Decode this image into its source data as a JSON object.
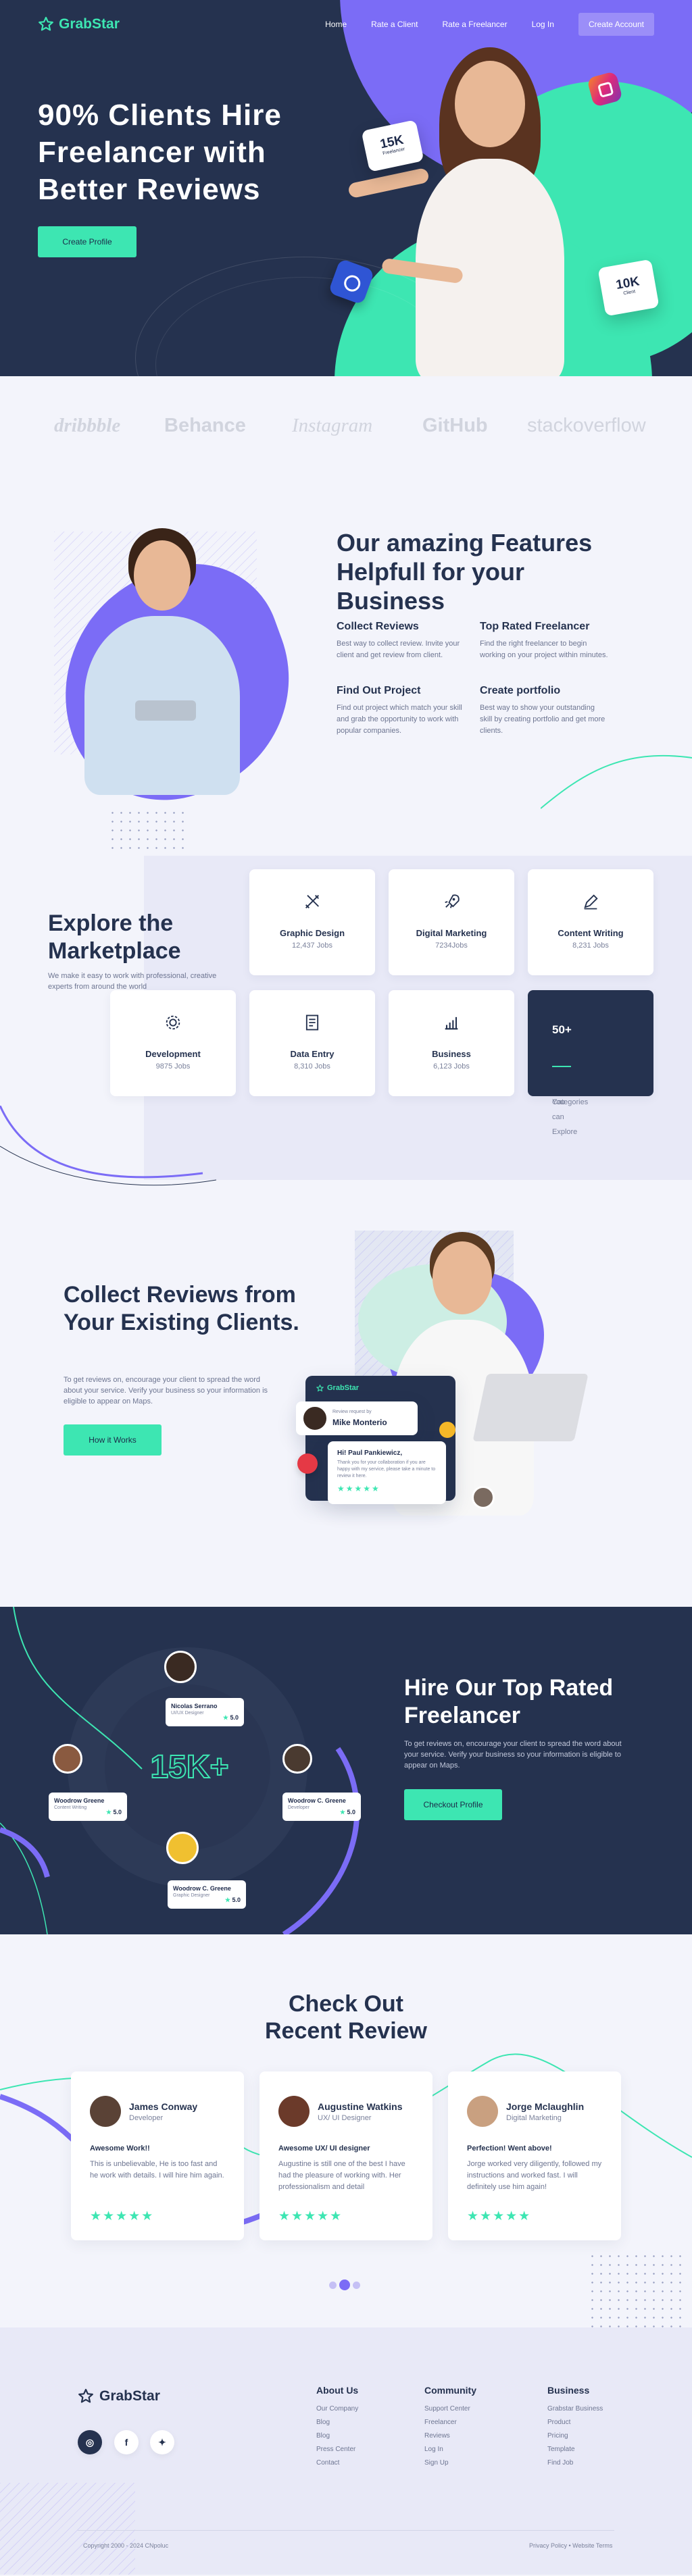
{
  "brand": {
    "name": "GrabStar",
    "accent": "#3de6b2",
    "purple": "#7b6cf6",
    "navy": "#25324f"
  },
  "nav": {
    "links": [
      "Home",
      "Rate a Client",
      "Rate a Freelancer",
      "Log In"
    ],
    "cta": "Create Account"
  },
  "hero": {
    "title": "90% Clients Hire Freelancer with Better Reviews",
    "button": "Create Profile",
    "badge1": {
      "value": "15K",
      "label": "Freelancer"
    },
    "badge2": {
      "value": "10K",
      "label": "Client"
    }
  },
  "brands": [
    "dribbble",
    "Behance",
    "Instagram",
    "GitHub",
    "stackoverflow"
  ],
  "features": {
    "title": "Our amazing Features Helpfull for your Business",
    "items": [
      {
        "title": "Collect Reviews",
        "text": "Best way to collect review. Invite your client and get review from client."
      },
      {
        "title": "Top Rated Freelancer",
        "text": "Find the right freelancer to begin working on your project within minutes."
      },
      {
        "title": "Find Out Project",
        "text": "Find out project which match your skill and grab the opportunity to work with popular companies."
      },
      {
        "title": "Create portfolio",
        "text": "Best way to show your outstanding skill by creating portfolio and get more clients."
      }
    ]
  },
  "market": {
    "title": "Explore the Marketplace",
    "subtitle": "We make it easy to work with professional, creative experts from around the world",
    "categories": [
      {
        "name": "Graphic Design",
        "jobs": "12,437 Jobs",
        "icon": "pencil-ruler-icon"
      },
      {
        "name": "Digital Marketing",
        "jobs": "7234Jobs",
        "icon": "rocket-icon"
      },
      {
        "name": "Content Writing",
        "jobs": "8,231 Jobs",
        "icon": "pen-icon"
      },
      {
        "name": "Development",
        "jobs": "9875 Jobs",
        "icon": "gear-icon"
      },
      {
        "name": "Data Entry",
        "jobs": "8,310 Jobs",
        "icon": "document-icon"
      },
      {
        "name": "Business",
        "jobs": "6,123 Jobs",
        "icon": "chart-icon"
      }
    ],
    "more": {
      "count": "50+",
      "label1": "Categories",
      "label2": "You can Explore"
    }
  },
  "collect": {
    "title": "Collect Reviews from Your Existing Clients.",
    "subtitle": "To get reviews on, encourage your client to spread the word about your service. Verify your business so your information is eligible to appear on Maps.",
    "button": "How it Works",
    "widget_brand": "GrabStar",
    "review_request": {
      "label": "Review request by",
      "name": "Mike Monterio"
    },
    "message": {
      "greeting": "Hi! Paul Pankiewicz,",
      "text": "Thank you for your collaboration if you are happy with my service, please take a minute to review it here."
    }
  },
  "hire": {
    "title": "Hire Our Top Rated Freelancer",
    "subtitle": "To get reviews on, encourage your client to spread the word about your service. Verify your business so your information is eligible to appear on Maps.",
    "button": "Checkout Profile",
    "counter": "15K+",
    "freelancers": [
      {
        "name": "Nicolas Serrano",
        "role": "UI/UX Designer",
        "rating": "5.0"
      },
      {
        "name": "Woodrow Greene",
        "role": "Content Writing",
        "rating": "5.0"
      },
      {
        "name": "Woodrow C. Greene",
        "role": "Developer",
        "rating": "5.0"
      },
      {
        "name": "Woodrow C. Greene",
        "role": "Graphic Designer",
        "rating": "5.0"
      }
    ]
  },
  "recent": {
    "title": "Check Out Recent Review",
    "reviews": [
      {
        "name": "James Conway",
        "role": "Developer",
        "headline": "Awesome Work!!",
        "text": "This is unbelievable, He is too fast and he work with details. I will hire him again.",
        "stars": "★★★★★"
      },
      {
        "name": "Augustine Watkins",
        "role": "UX/ UI Designer",
        "headline": "Awesome UX/ UI designer",
        "text": "Augustine is still one of the best I have had the pleasure of working with. Her professionalism and detail",
        "stars": "★★★★★"
      },
      {
        "name": "Jorge Mclaughlin",
        "role": "Digital Marketing",
        "headline": "Perfection! Went above!",
        "text": "Jorge worked very diligently, followed my instructions and worked fast. I will definitely use him again!",
        "stars": "★★★★★"
      }
    ]
  },
  "footer": {
    "brand": "GrabStar",
    "columns": [
      {
        "title": "About Us",
        "links": [
          "Our Company",
          "Blog",
          "Blog",
          "Press Center",
          "Contact"
        ]
      },
      {
        "title": "Community",
        "links": [
          "Support Center",
          "Freelancer",
          "Reviews",
          "Log In",
          "Sign Up"
        ]
      },
      {
        "title": "Business",
        "links": [
          "Grabstar Business",
          "Product",
          "Pricing",
          "Template",
          "Find Job"
        ]
      }
    ],
    "copyright": "Copyright 2000 - 2024 CNpoluc",
    "legal": "Privacy Policy  •  Website Terms"
  }
}
